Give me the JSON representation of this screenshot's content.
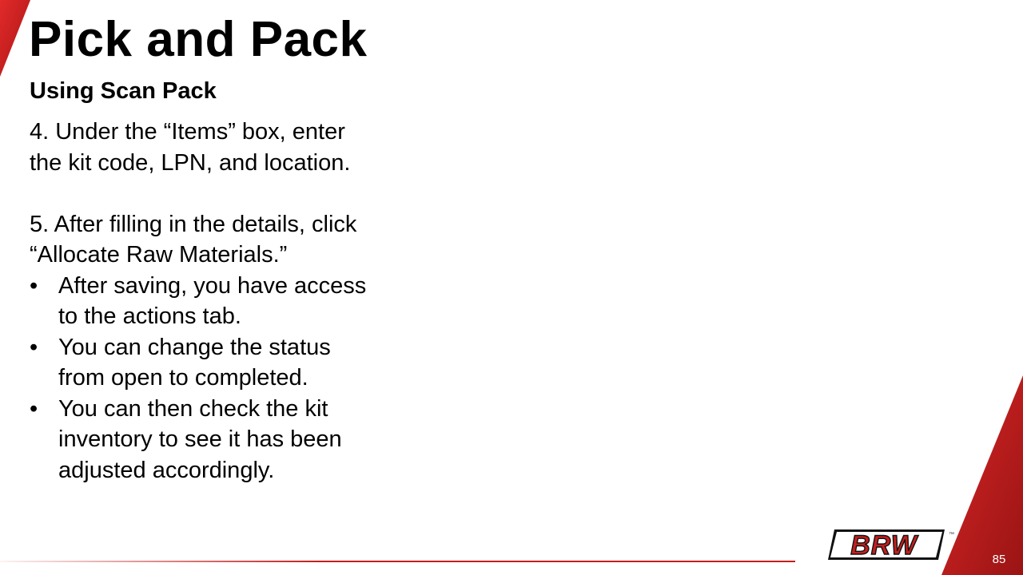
{
  "slide": {
    "title": "Pick and Pack",
    "subtitle": "Using Scan Pack",
    "paragraphs": [
      "4. Under the “Items” box, enter the kit code, LPN, and location.",
      "5. After filling in the details, click “Allocate Raw Materials.”"
    ],
    "bullets": [
      "After saving, you have access to the actions tab.",
      "You can change the status from open to completed.",
      "You can then check the kit inventory to see it has been adjusted accordingly."
    ],
    "bullet_glyph": "•",
    "page_number": "85"
  },
  "logo": {
    "text": "BRW",
    "trademark": "™"
  },
  "colors": {
    "accent_red": "#c41e1e",
    "dark_red": "#8e1212",
    "text": "#000000",
    "background": "#ffffff"
  }
}
